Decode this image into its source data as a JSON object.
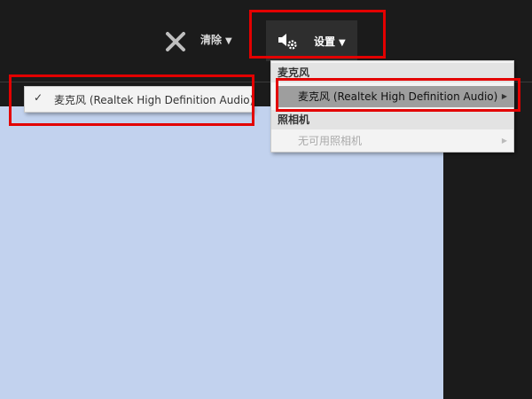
{
  "toolbar": {
    "clear_label": "清除",
    "settings_label": "设置",
    "caret": "▼"
  },
  "icons": {
    "close": "close-icon",
    "settings": "speaker-gear-icon",
    "check": "check-icon",
    "submenu_arrow": "chevron-right-icon"
  },
  "dropdown": {
    "microphone_header": "麦克风",
    "microphone_item": "麦克风 (Realtek High Definition Audio)",
    "camera_header": "照相机",
    "camera_item": "无可用照相机"
  },
  "submenu": {
    "check": "✓",
    "label": "麦克风 (Realtek High Definition Audio)"
  },
  "glyphs": {
    "submenu_arrow": "▶"
  },
  "colors": {
    "highlight": "#e30000",
    "canvas": "#c2d2ee",
    "toolbar": "#1b1b1b",
    "selected_item": "#9e9e9e"
  }
}
